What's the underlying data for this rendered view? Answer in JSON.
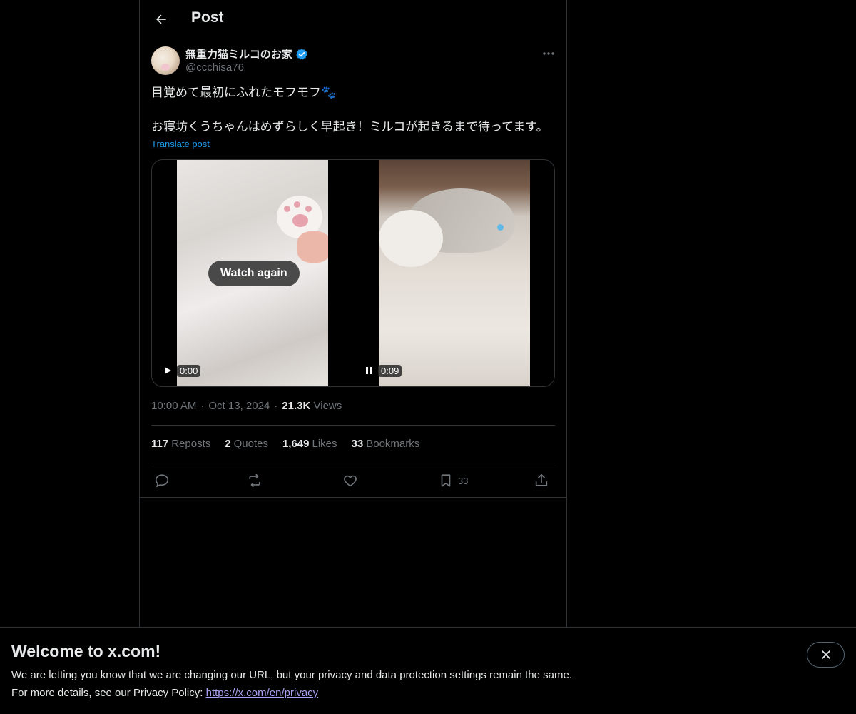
{
  "header": {
    "title": "Post"
  },
  "author": {
    "display_name": "無重力猫ミルコのお家",
    "handle": "@ccchisa76",
    "verified": true
  },
  "post": {
    "text": "目覚めて最初にふれたモフモフ🐾\n\nお寝坊くうちゃんはめずらしく早起き！ミルコが起きるまで待ってます。",
    "translate_label": "Translate post"
  },
  "media": {
    "video_1": {
      "overlay_button": "Watch again",
      "time": "0:00",
      "state": "play-icon"
    },
    "video_2": {
      "time": "0:09",
      "state": "pause-icon"
    }
  },
  "meta": {
    "time": "10:00 AM",
    "date": "Oct 13, 2024",
    "views_count": "21.3K",
    "views_label": "Views"
  },
  "stats": [
    {
      "count": "117",
      "label": "Reposts"
    },
    {
      "count": "2",
      "label": "Quotes"
    },
    {
      "count": "1,649",
      "label": "Likes"
    },
    {
      "count": "33",
      "label": "Bookmarks"
    }
  ],
  "actions": {
    "bookmark_count": "33"
  },
  "banner": {
    "title": "Welcome to x.com!",
    "line1": "We are letting you know that we are changing our URL, but your privacy and data protection settings remain the same.",
    "line2_prefix": "For more details, see our Privacy Policy:",
    "link": "https://x.com/en/privacy"
  },
  "colors": {
    "accent": "#1d9bf0",
    "muted": "#71767b",
    "text": "#e7e9ea",
    "border": "#2f3336",
    "link": "#a9a3f5"
  }
}
